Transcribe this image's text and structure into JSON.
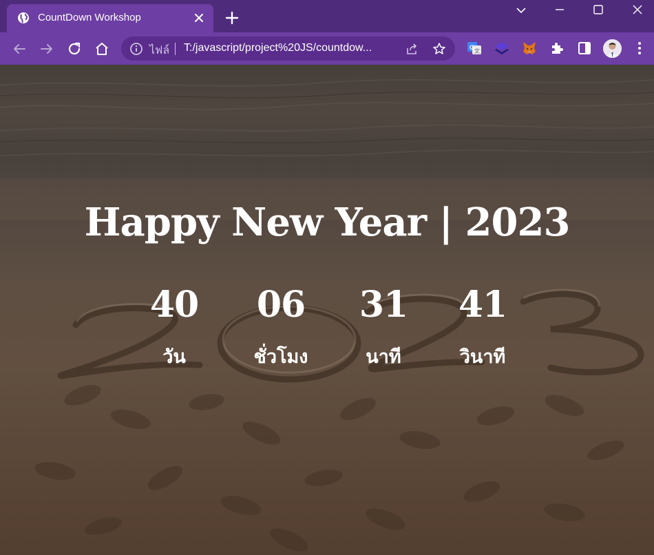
{
  "browser": {
    "tab": {
      "title": "CountDown Workshop",
      "favicon": "globe-icon"
    },
    "omnibox": {
      "scheme_label": "ไฟล์",
      "url": "T:/javascript/project%20JS/countdow..."
    },
    "colors": {
      "frame": "#4f2b7c",
      "toolbar": "#6d3ea3",
      "omnibox": "#5a2d8c"
    }
  },
  "page": {
    "headline": "Happy New Year | 2023",
    "countdown": {
      "days": {
        "value": "40",
        "label": "วัน"
      },
      "hours": {
        "value": "06",
        "label": "ชั่วโมง"
      },
      "minutes": {
        "value": "31",
        "label": "นาที"
      },
      "seconds": {
        "value": "41",
        "label": "วินาที"
      }
    },
    "background": "beach-sand-2023-photo"
  }
}
